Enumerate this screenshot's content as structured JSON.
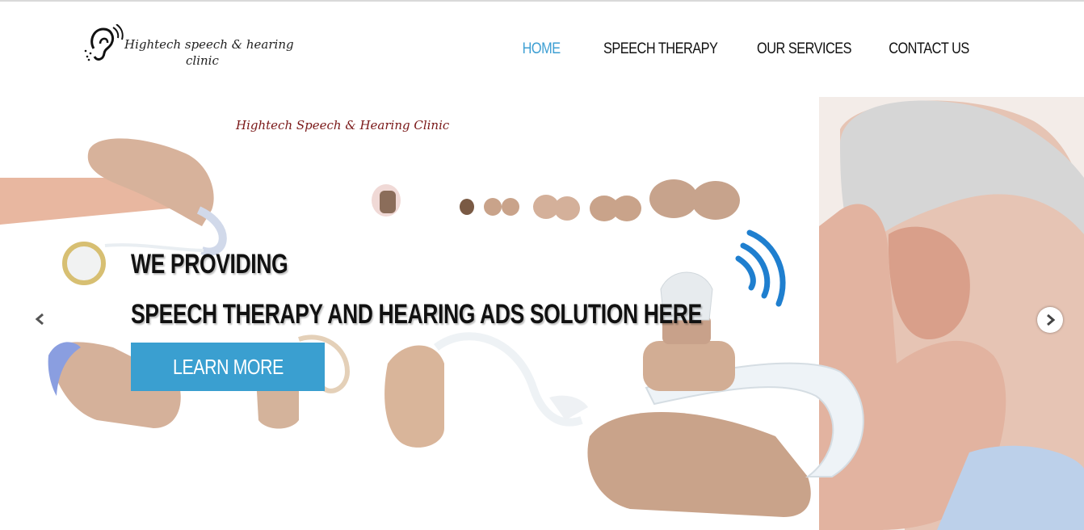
{
  "header": {
    "logo_line1": "Hightech speech &  hearing",
    "logo_line2": "clinic"
  },
  "nav": {
    "items": [
      {
        "label": "HOME",
        "active": true
      },
      {
        "label": "SPEECH THERAPY",
        "active": false
      },
      {
        "label": "OUR SERVICES",
        "active": false
      },
      {
        "label": "CONTACT US",
        "active": false
      }
    ]
  },
  "slider": {
    "caption": "Hightech Speech & Hearing Clinic",
    "headline_1": "WE PROVIDING",
    "headline_2": "SPEECH THERAPY AND HEARING ADS SOLUTION HERE",
    "button_label": "LEARN MORE",
    "prev_icon": "chevron-left-icon",
    "next_icon": "chevron-right-icon"
  },
  "colors": {
    "accent": "#3d9fd3",
    "button": "#3a9fd0",
    "caption": "#7a1818",
    "device_beige": "#d7b29b"
  }
}
